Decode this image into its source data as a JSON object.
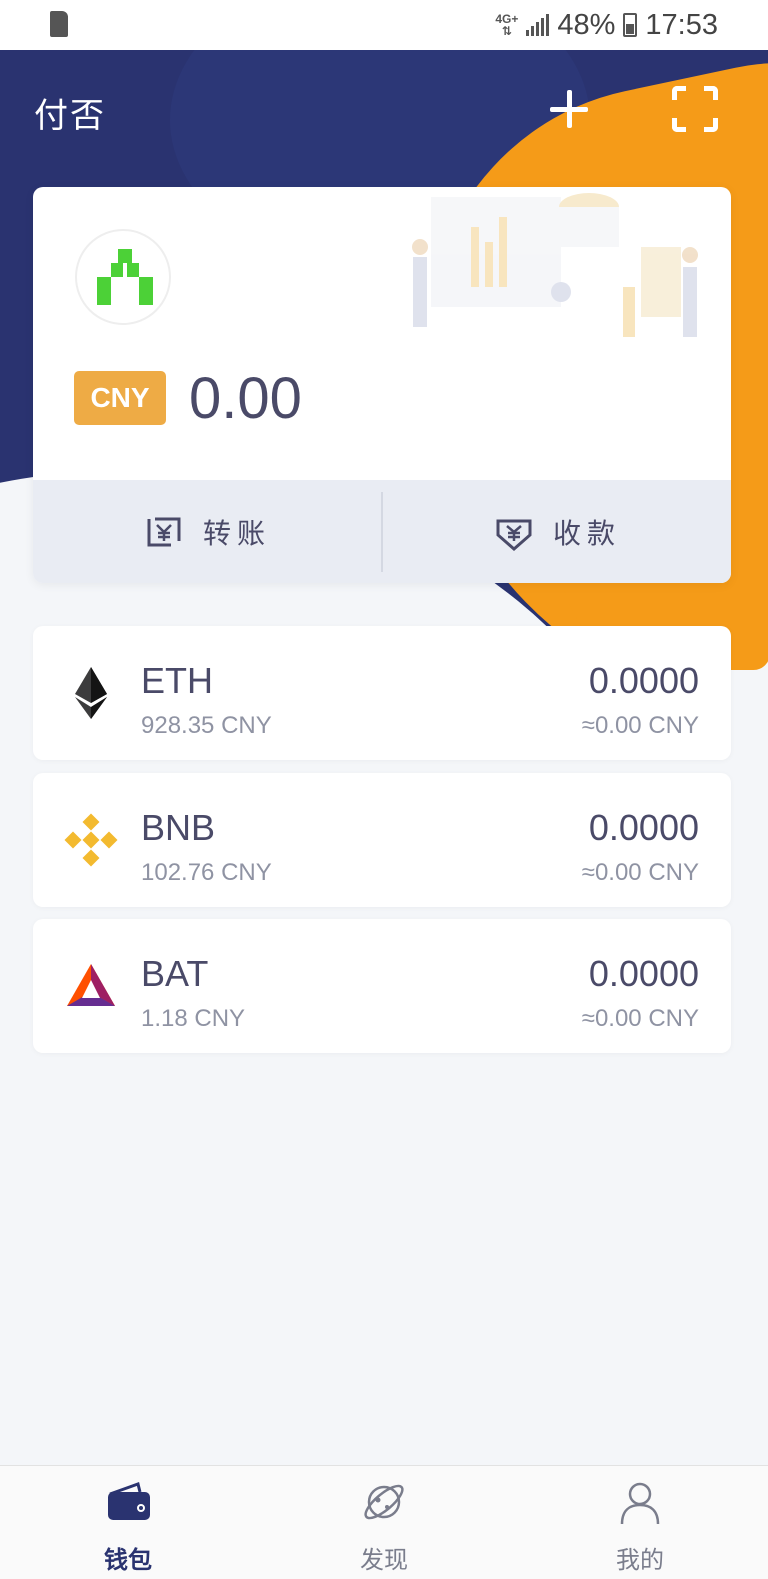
{
  "status_bar": {
    "network": "4G+",
    "battery": "48%",
    "time": "17:53"
  },
  "header": {
    "title": "付否"
  },
  "wallet": {
    "currency": "CNY",
    "balance": "0.00",
    "actions": {
      "transfer_label": "转账",
      "receive_label": "收款"
    }
  },
  "tokens": [
    {
      "symbol": "ETH",
      "price": "928.35 CNY",
      "amount": "0.0000",
      "value": "≈0.00 CNY",
      "icon": "eth-icon"
    },
    {
      "symbol": "BNB",
      "price": "102.76 CNY",
      "amount": "0.0000",
      "value": "≈0.00 CNY",
      "icon": "bnb-icon"
    },
    {
      "symbol": "BAT",
      "price": "1.18 CNY",
      "amount": "0.0000",
      "value": "≈0.00 CNY",
      "icon": "bat-icon"
    }
  ],
  "bottom_nav": {
    "items": [
      {
        "label": "钱包",
        "icon": "wallet-icon",
        "active": true
      },
      {
        "label": "发现",
        "icon": "planet-icon",
        "active": false
      },
      {
        "label": "我的",
        "icon": "user-icon",
        "active": false
      }
    ]
  },
  "colors": {
    "header_navy": "#2a3370",
    "accent_orange": "#f59b18",
    "tag_orange": "#eeab45",
    "text_primary": "#4a4a68",
    "text_secondary": "#8f93a3"
  }
}
